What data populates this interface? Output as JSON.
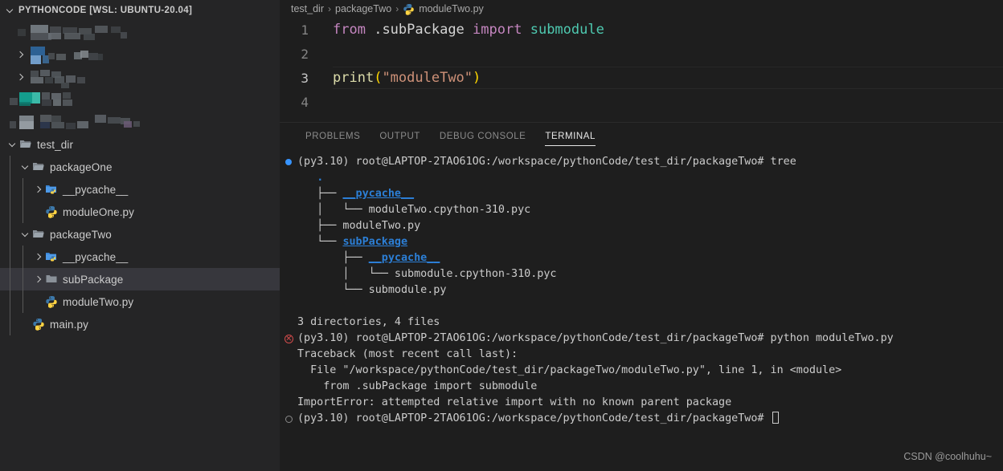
{
  "sidebar": {
    "title": "PYTHONCODE [WSL: UBUNTU-20.04]",
    "censored_rows": 5,
    "tree": [
      {
        "label": "test_dir",
        "indent": 0,
        "icon": "folder-open-icon",
        "chevron": "down",
        "selected": false
      },
      {
        "label": "packageOne",
        "indent": 1,
        "icon": "folder-open-icon",
        "chevron": "down",
        "selected": false
      },
      {
        "label": "__pycache__",
        "indent": 2,
        "icon": "python-folder-icon",
        "chevron": "right",
        "selected": false
      },
      {
        "label": "moduleOne.py",
        "indent": 2,
        "icon": "python-file-icon",
        "chevron": "none",
        "selected": false
      },
      {
        "label": "packageTwo",
        "indent": 1,
        "icon": "folder-open-icon",
        "chevron": "down",
        "selected": false
      },
      {
        "label": "__pycache__",
        "indent": 2,
        "icon": "python-folder-icon",
        "chevron": "right",
        "selected": false
      },
      {
        "label": "subPackage",
        "indent": 2,
        "icon": "folder-icon",
        "chevron": "right",
        "selected": true
      },
      {
        "label": "moduleTwo.py",
        "indent": 2,
        "icon": "python-file-icon",
        "chevron": "none",
        "selected": false
      },
      {
        "label": "main.py",
        "indent": 1,
        "icon": "python-file-icon",
        "chevron": "none",
        "selected": false
      }
    ]
  },
  "breadcrumb": {
    "parts": [
      "test_dir",
      "packageTwo"
    ],
    "file": "moduleTwo.py",
    "separator": "›"
  },
  "editor": {
    "lines": [
      {
        "n": "1",
        "active": false,
        "tokens": [
          {
            "t": "from",
            "c": "kw"
          },
          {
            "t": " ",
            "c": "mod"
          },
          {
            "t": ".subPackage",
            "c": "mod"
          },
          {
            "t": " ",
            "c": "mod"
          },
          {
            "t": "import",
            "c": "kw"
          },
          {
            "t": " ",
            "c": "mod"
          },
          {
            "t": "submodule",
            "c": "cls"
          }
        ]
      },
      {
        "n": "2",
        "active": false,
        "tokens": []
      },
      {
        "n": "3",
        "active": true,
        "tokens": [
          {
            "t": "print",
            "c": "fn"
          },
          {
            "t": "(",
            "c": "pn"
          },
          {
            "t": "\"moduleTwo\"",
            "c": "str"
          },
          {
            "t": ")",
            "c": "pn"
          }
        ]
      },
      {
        "n": "4",
        "active": false,
        "tokens": []
      }
    ]
  },
  "panel": {
    "tabs": [
      {
        "label": "PROBLEMS",
        "active": false
      },
      {
        "label": "OUTPUT",
        "active": false
      },
      {
        "label": "DEBUG CONSOLE",
        "active": false
      },
      {
        "label": "TERMINAL",
        "active": true
      }
    ]
  },
  "terminal": {
    "lines": [
      {
        "mark": "success-dot",
        "segments": [
          {
            "t": "(py3.10) root@LAPTOP-2TAO61OG:/workspace/pythonCode/test_dir/packageTwo# tree",
            "c": "plain"
          }
        ]
      },
      {
        "mark": "none",
        "segments": [
          {
            "t": "   ",
            "c": "plain"
          },
          {
            "t": ".",
            "c": "dir-plain"
          }
        ]
      },
      {
        "mark": "none",
        "segments": [
          {
            "t": "   ├── ",
            "c": "plain"
          },
          {
            "t": "__pycache__",
            "c": "dir"
          }
        ]
      },
      {
        "mark": "none",
        "segments": [
          {
            "t": "   │   └── moduleTwo.cpython-310.pyc",
            "c": "plain"
          }
        ]
      },
      {
        "mark": "none",
        "segments": [
          {
            "t": "   ├── moduleTwo.py",
            "c": "plain"
          }
        ]
      },
      {
        "mark": "none",
        "segments": [
          {
            "t": "   └── ",
            "c": "plain"
          },
          {
            "t": "subPackage",
            "c": "dir"
          }
        ]
      },
      {
        "mark": "none",
        "segments": [
          {
            "t": "       ├── ",
            "c": "plain"
          },
          {
            "t": "__pycache__",
            "c": "dir"
          }
        ]
      },
      {
        "mark": "none",
        "segments": [
          {
            "t": "       │   └── submodule.cpython-310.pyc",
            "c": "plain"
          }
        ]
      },
      {
        "mark": "none",
        "segments": [
          {
            "t": "       └── submodule.py",
            "c": "plain"
          }
        ]
      },
      {
        "mark": "none",
        "segments": [
          {
            "t": "",
            "c": "plain"
          }
        ]
      },
      {
        "mark": "none",
        "segments": [
          {
            "t": "3 directories, 4 files",
            "c": "plain"
          }
        ]
      },
      {
        "mark": "error",
        "segments": [
          {
            "t": "(py3.10) root@LAPTOP-2TAO61OG:/workspace/pythonCode/test_dir/packageTwo# python moduleTwo.py",
            "c": "plain"
          }
        ]
      },
      {
        "mark": "none",
        "segments": [
          {
            "t": "Traceback (most recent call last):",
            "c": "plain"
          }
        ]
      },
      {
        "mark": "none",
        "segments": [
          {
            "t": "  File \"/workspace/pythonCode/test_dir/packageTwo/moduleTwo.py\", line 1, in <module>",
            "c": "plain"
          }
        ]
      },
      {
        "mark": "none",
        "segments": [
          {
            "t": "    from .subPackage import submodule",
            "c": "plain"
          }
        ]
      },
      {
        "mark": "none",
        "segments": [
          {
            "t": "ImportError: attempted relative import with no known parent package",
            "c": "plain"
          }
        ]
      },
      {
        "mark": "idle",
        "segments": [
          {
            "t": "(py3.10) root@LAPTOP-2TAO61OG:/workspace/pythonCode/test_dir/packageTwo# ",
            "c": "plain"
          },
          {
            "t": "CURSOR",
            "c": "cursor"
          }
        ]
      }
    ]
  },
  "watermark": {
    "text": "CSDN @coolhuhu~"
  },
  "colors": {
    "sidebar_bg": "#252526",
    "editor_bg": "#1e1e1e",
    "selected_row": "#37373d",
    "accent_blue": "#3794ff",
    "terminal_dir": "#2c7fd6",
    "error_red": "#d14b4b",
    "text": "#cccccc"
  }
}
